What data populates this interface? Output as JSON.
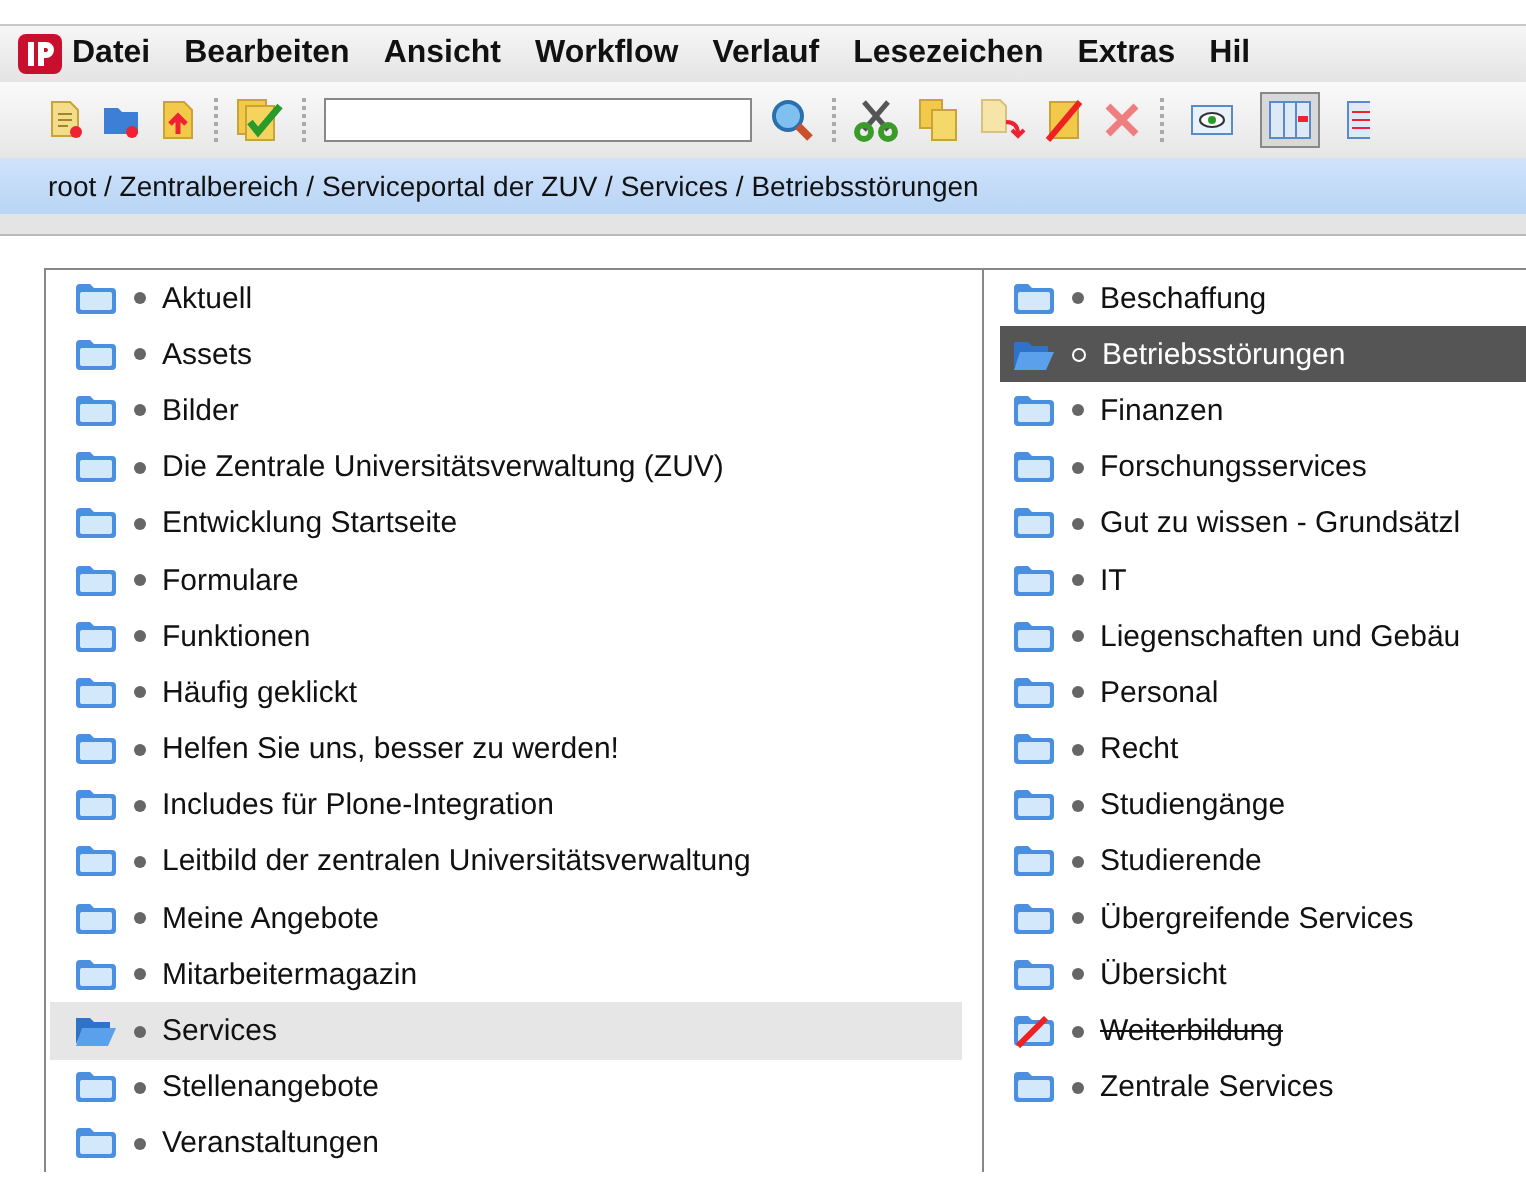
{
  "menu": [
    "Datei",
    "Bearbeiten",
    "Ansicht",
    "Workflow",
    "Verlauf",
    "Lesezeichen",
    "Extras",
    "Hil"
  ],
  "toolbar": {
    "view_buttons": [
      {
        "kind": "preview",
        "selected": false
      },
      {
        "kind": "columns",
        "selected": true
      },
      {
        "kind": "list",
        "selected": false
      }
    ]
  },
  "breadcrumb": "root / Zentralbereich / Serviceportal der ZUV / Services / Betriebsstörungen",
  "columns": [
    {
      "focused": false,
      "items": [
        {
          "label": "Aktuell",
          "selected": false,
          "disabled": false
        },
        {
          "label": "Assets",
          "selected": false,
          "disabled": false
        },
        {
          "label": "Bilder",
          "selected": false,
          "disabled": false
        },
        {
          "label": "Die Zentrale Universitätsverwaltung (ZUV)",
          "selected": false,
          "disabled": false
        },
        {
          "label": "Entwicklung Startseite",
          "selected": false,
          "disabled": false
        },
        {
          "label": "Formulare",
          "selected": false,
          "disabled": false
        },
        {
          "label": "Funktionen",
          "selected": false,
          "disabled": false
        },
        {
          "label": "Häufig geklickt",
          "selected": false,
          "disabled": false
        },
        {
          "label": "Helfen Sie uns, besser zu werden!",
          "selected": false,
          "disabled": false
        },
        {
          "label": "Includes für Plone-Integration",
          "selected": false,
          "disabled": false
        },
        {
          "label": "Leitbild der zentralen Universitätsverwaltung",
          "selected": false,
          "disabled": false
        },
        {
          "label": "Meine Angebote",
          "selected": false,
          "disabled": false
        },
        {
          "label": "Mitarbeitermagazin",
          "selected": false,
          "disabled": false
        },
        {
          "label": "Services",
          "selected": true,
          "disabled": false
        },
        {
          "label": "Stellenangebote",
          "selected": false,
          "disabled": false
        },
        {
          "label": "Veranstaltungen",
          "selected": false,
          "disabled": false
        }
      ]
    },
    {
      "focused": true,
      "items": [
        {
          "label": "Beschaffung",
          "selected": false,
          "disabled": false
        },
        {
          "label": "Betriebsstörungen",
          "selected": true,
          "disabled": false
        },
        {
          "label": "Finanzen",
          "selected": false,
          "disabled": false
        },
        {
          "label": "Forschungsservices",
          "selected": false,
          "disabled": false
        },
        {
          "label": "Gut zu wissen - Grundsätzl",
          "selected": false,
          "disabled": false
        },
        {
          "label": "IT",
          "selected": false,
          "disabled": false
        },
        {
          "label": "Liegenschaften und Gebäu",
          "selected": false,
          "disabled": false
        },
        {
          "label": "Personal",
          "selected": false,
          "disabled": false
        },
        {
          "label": "Recht",
          "selected": false,
          "disabled": false
        },
        {
          "label": "Studiengänge",
          "selected": false,
          "disabled": false
        },
        {
          "label": "Studierende",
          "selected": false,
          "disabled": false
        },
        {
          "label": "Übergreifende Services",
          "selected": false,
          "disabled": false
        },
        {
          "label": "Übersicht",
          "selected": false,
          "disabled": false
        },
        {
          "label": "Weiterbildung",
          "selected": false,
          "disabled": true
        },
        {
          "label": "Zentrale Services",
          "selected": false,
          "disabled": false
        }
      ]
    }
  ]
}
